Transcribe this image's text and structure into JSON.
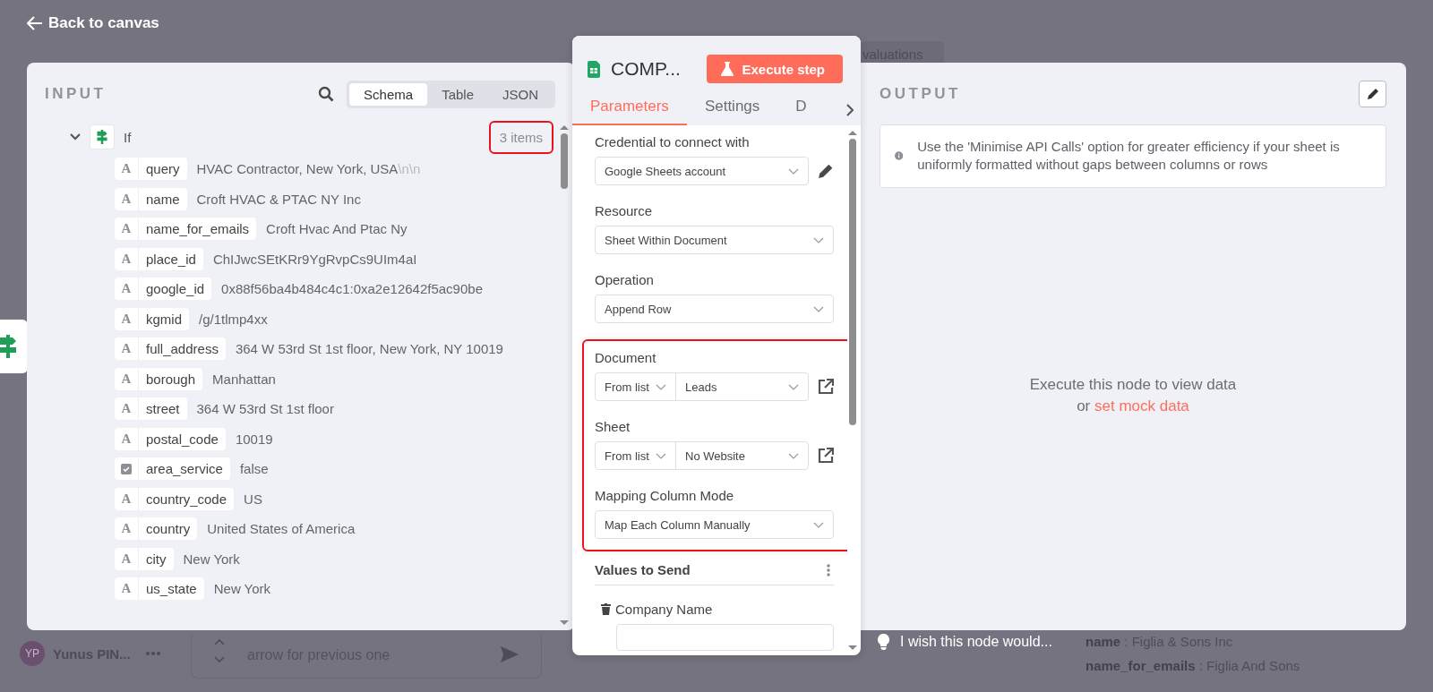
{
  "background": {
    "back_link": "Back to canvas",
    "tab": "valuations",
    "user": {
      "initials": "YP",
      "name": "Yunus PIN..."
    },
    "chat_placeholder": "arrow for previous one",
    "output_rows": [
      {
        "key": "name",
        "value": ": Figlia & Sons Inc"
      },
      {
        "key": "name_for_emails",
        "value": ": Figlia And Sons"
      }
    ]
  },
  "input": {
    "title": "INPUT",
    "views": [
      {
        "label": "Schema",
        "selected": true
      },
      {
        "label": "Table",
        "selected": false
      },
      {
        "label": "JSON",
        "selected": false
      }
    ],
    "node": {
      "name": "If",
      "expanded": true,
      "count": {
        "text": "3 items",
        "highlighted": true
      },
      "fields": [
        {
          "kind": "text",
          "glyph": "A",
          "key": "query",
          "value": "HVAC Contractor, New York, USA",
          "escapes": "\\n\\n"
        },
        {
          "kind": "text",
          "glyph": "A",
          "key": "name",
          "value": "Croft HVAC & PTAC NY Inc"
        },
        {
          "kind": "text",
          "glyph": "A",
          "key": "name_for_emails",
          "value": "Croft Hvac And Ptac Ny"
        },
        {
          "kind": "text",
          "glyph": "A",
          "key": "place_id",
          "value": "ChIJwcSEtKRr9YgRvpCs9UIm4aI"
        },
        {
          "kind": "text",
          "glyph": "A",
          "key": "google_id",
          "value": "0x88f56ba4b484c4c1:0xa2e12642f5ac90be"
        },
        {
          "kind": "text",
          "glyph": "A",
          "key": "kgmid",
          "value": "/g/1tlmp4xx"
        },
        {
          "kind": "text",
          "glyph": "A",
          "key": "full_address",
          "value": "364 W 53rd St 1st floor, New York, NY 10019"
        },
        {
          "kind": "text",
          "glyph": "A",
          "key": "borough",
          "value": "Manhattan"
        },
        {
          "kind": "text",
          "glyph": "A",
          "key": "street",
          "value": "364 W 53rd St 1st floor"
        },
        {
          "kind": "text",
          "glyph": "A",
          "key": "postal_code",
          "value": "10019"
        },
        {
          "kind": "checkbox",
          "key": "area_service",
          "value": "false"
        },
        {
          "kind": "text",
          "glyph": "A",
          "key": "country_code",
          "value": "US"
        },
        {
          "kind": "text",
          "glyph": "A",
          "key": "country",
          "value": "United States of America"
        },
        {
          "kind": "text",
          "glyph": "A",
          "key": "city",
          "value": "New York"
        },
        {
          "kind": "text",
          "glyph": "A",
          "key": "us_state",
          "value": "New York"
        }
      ]
    }
  },
  "node_panel": {
    "title": "COMP...",
    "execute_button": "Execute step",
    "tabs": [
      {
        "label": "Parameters",
        "selected": true
      },
      {
        "label": "Settings",
        "selected": false
      },
      {
        "label": "D",
        "selected": false
      }
    ],
    "parameter_groups": [
      {
        "highlighted": false,
        "items": [
          {
            "kind": "select",
            "label": "Credential to connect with",
            "value": "Google Sheets account",
            "editable": true
          },
          {
            "kind": "select",
            "label": "Resource",
            "value": "Sheet Within Document",
            "editable": false
          },
          {
            "kind": "select",
            "label": "Operation",
            "value": "Append Row",
            "editable": false
          }
        ]
      },
      {
        "highlighted": true,
        "items": [
          {
            "kind": "locator",
            "label": "Document",
            "mode": "From list",
            "value": "Leads"
          },
          {
            "kind": "locator",
            "label": "Sheet",
            "mode": "From list",
            "value": "No Website"
          },
          {
            "kind": "select",
            "label": "Mapping Column Mode",
            "value": "Map Each Column Manually",
            "editable": false
          }
        ]
      }
    ],
    "values_section": {
      "title": "Values to Send",
      "fields": [
        {
          "label": "Company Name"
        }
      ]
    }
  },
  "output": {
    "title": "OUTPUT",
    "notice": "Use the 'Minimise API Calls' option for greater efficiency if your sheet is uniformly formatted without gaps between columns or rows",
    "empty_message": "Execute this node to view data",
    "empty_or": "or",
    "mock_link": "set mock data"
  },
  "feedback": "I wish this node would..."
}
